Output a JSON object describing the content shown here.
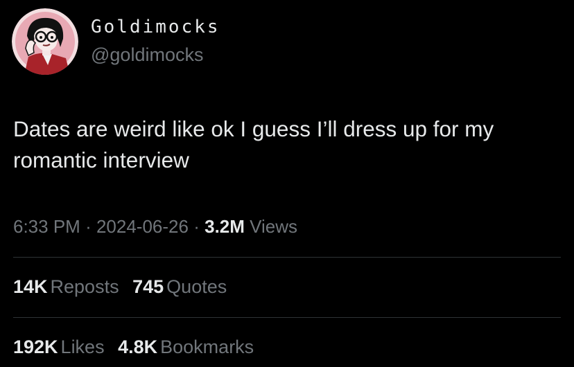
{
  "author": {
    "display_name": "Goldimocks",
    "handle": "@goldimocks",
    "avatar_icon": "profile-avatar-cartoon-woman"
  },
  "tweet": {
    "text": "Dates are weird like ok I guess I’ll dress up for my romantic interview"
  },
  "meta": {
    "time": "6:33 PM",
    "separator": "·",
    "date": "2024-06-26",
    "views_count": "3.2M",
    "views_label": "Views"
  },
  "stats_row_1": [
    {
      "count": "14K",
      "label": "Reposts"
    },
    {
      "count": "745",
      "label": "Quotes"
    }
  ],
  "stats_row_2": [
    {
      "count": "192K",
      "label": "Likes"
    },
    {
      "count": "4.8K",
      "label": "Bookmarks"
    }
  ],
  "colors": {
    "background": "#000000",
    "primary_text": "#e7e9ea",
    "secondary_text": "#71767b",
    "divider": "#2f3336",
    "avatar_background": "#e8a9b4",
    "avatar_jacket": "#a8232a"
  }
}
